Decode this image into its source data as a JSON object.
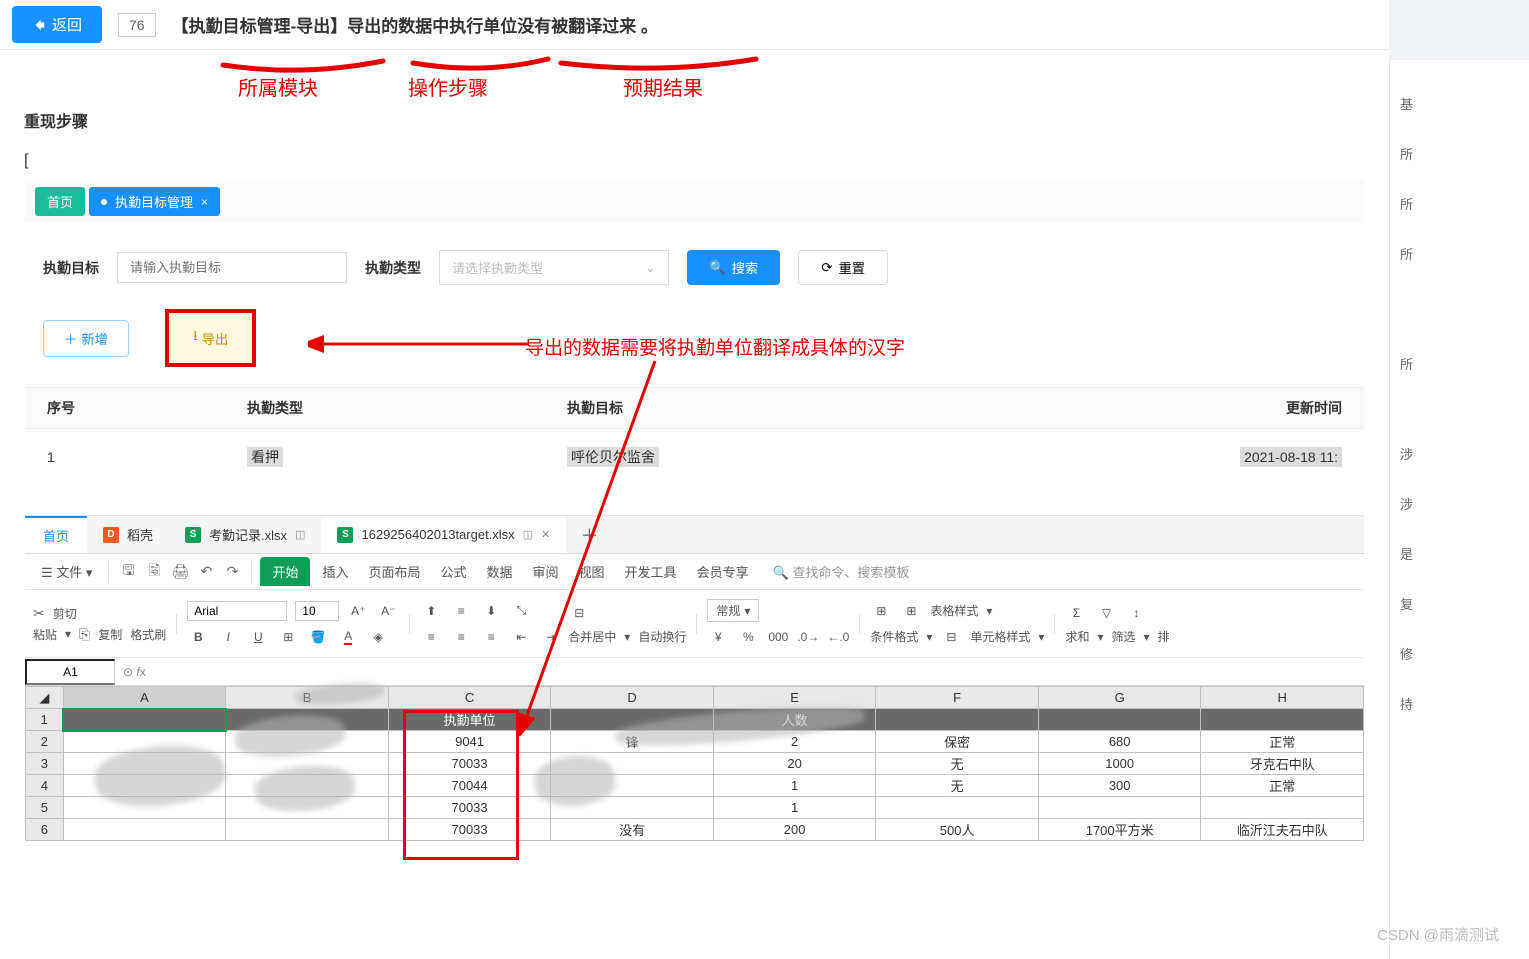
{
  "topbar": {
    "back_label": "返回",
    "id": "76",
    "title": "【执勤目标管理-导出】导出的数据中执行单位没有被翻译过来 。"
  },
  "annotations": {
    "module": "所属模块",
    "steps": "操作步骤",
    "expected": "预期结果",
    "overlay": "导出的数据需要将执勤单位翻译成具体的汉字"
  },
  "section": {
    "title": "重现步骤",
    "bracket": "["
  },
  "webapp": {
    "tabs": {
      "home": "首页",
      "active": "执勤目标管理",
      "close": "×"
    },
    "filters": {
      "target_label": "执勤目标",
      "target_placeholder": "请输入执勤目标",
      "type_label": "执勤类型",
      "type_placeholder": "请选择执勤类型",
      "search": "搜索",
      "reset": "重置"
    },
    "buttons": {
      "add": "新增",
      "export": "导出"
    },
    "table": {
      "headers": [
        "序号",
        "执勤类型",
        "执勤目标",
        "更新时间"
      ],
      "rows": [
        {
          "seq": "1",
          "type": "看押",
          "target": "呼伦贝尔监舍",
          "time": "2021-08-18 11:"
        }
      ]
    }
  },
  "wps": {
    "hometab": "首页",
    "file1": "稻壳",
    "file2": "考勤记录.xlsx",
    "file3": "1629256402013target.xlsx",
    "menu": {
      "file": "文件",
      "start": "开始",
      "insert": "插入",
      "layout": "页面布局",
      "formula": "公式",
      "data": "数据",
      "review": "审阅",
      "view": "视图",
      "dev": "开发工具",
      "vip": "会员专享",
      "search": "查找命令、搜索模板"
    },
    "ribbon": {
      "cut": "剪切",
      "paste": "粘贴",
      "copy": "复制",
      "format": "格式刷",
      "font": "Arial",
      "size": "10",
      "merge": "合并居中",
      "wrap": "自动换行",
      "numfmt": "常规",
      "cond": "条件格式",
      "tblfmt": "表格样式",
      "cellfmt": "单元格样式",
      "sum": "求和",
      "filter": "筛选",
      "sort": "排"
    },
    "cellref": "A1",
    "cols": [
      "A",
      "B",
      "C",
      "D",
      "E",
      "F",
      "G",
      "H"
    ],
    "sheet": {
      "header_c": "执勤单位",
      "header_e_frag": "人数",
      "rows": [
        {
          "c": "9041",
          "d": "锋",
          "e": "2",
          "f": "保密",
          "g": "680",
          "h": "正常"
        },
        {
          "c": "70033",
          "d": "",
          "e": "20",
          "f": "无",
          "g": "1000",
          "h": "牙克石中队"
        },
        {
          "c": "70044",
          "d": "",
          "e": "1",
          "f": "无",
          "g": "300",
          "h": "正常"
        },
        {
          "c": "70033",
          "d": "",
          "e": "1",
          "f": "",
          "g": "",
          "h": ""
        },
        {
          "c": "70033",
          "d": "没有",
          "e": "200",
          "f": "500人",
          "g": "1700平方米",
          "h": "临沂江夫石中队"
        }
      ]
    }
  },
  "watermark": "CSDN @雨滴测试"
}
